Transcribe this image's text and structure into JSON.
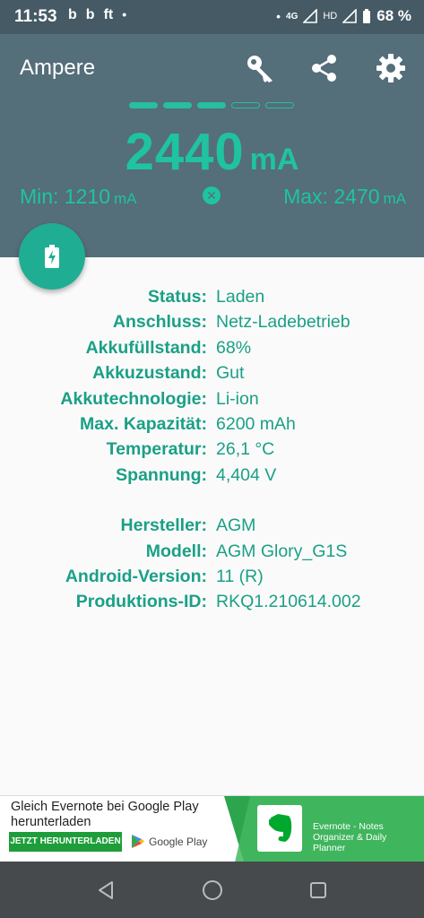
{
  "status_bar": {
    "time": "11:53",
    "left_icons": [
      "b",
      "b",
      "ft",
      "•"
    ],
    "network": "4G",
    "hd": "HD",
    "battery": "68 %"
  },
  "app": {
    "title": "Ampere",
    "colors": {
      "header": "#546e7a",
      "accent": "#1fc3a1",
      "label": "#1aa086"
    }
  },
  "toolbar": {
    "icons": [
      "key-icon",
      "share-icon",
      "gear-icon"
    ]
  },
  "meter": {
    "level_segments_total": 5,
    "level_segments_filled": 3,
    "current_value": "2440",
    "current_unit": "mA",
    "min_label": "Min: 1210",
    "min_unit": "mA",
    "max_label": "Max: 2470",
    "max_unit": "mA"
  },
  "battery_info": [
    {
      "key": "Status:",
      "value": "Laden"
    },
    {
      "key": "Anschluss:",
      "value": "Netz-Ladebetrieb"
    },
    {
      "key": "Akkufüllstand:",
      "value": "68%"
    },
    {
      "key": "Akkuzustand:",
      "value": "Gut"
    },
    {
      "key": "Akkutechnologie:",
      "value": "Li-ion"
    },
    {
      "key": "Max. Kapazität:",
      "value": "6200 mAh"
    },
    {
      "key": "Temperatur:",
      "value": "26,1 °C"
    },
    {
      "key": "Spannung:",
      "value": "4,404 V"
    }
  ],
  "device_info": [
    {
      "key": "Hersteller:",
      "value": "AGM"
    },
    {
      "key": "Modell:",
      "value": "AGM Glory_G1S"
    },
    {
      "key": "Android-Version:",
      "value": "11 (R)"
    },
    {
      "key": "Produktions-ID:",
      "value": "RKQ1.210614.002"
    }
  ],
  "ad": {
    "headline": "Gleich Evernote bei Google Play herunterladen",
    "cta": "JETZT HERUNTERLADEN",
    "store": "Google Play",
    "app_name": "Evernote - Notes Organizer & Daily Planner"
  }
}
